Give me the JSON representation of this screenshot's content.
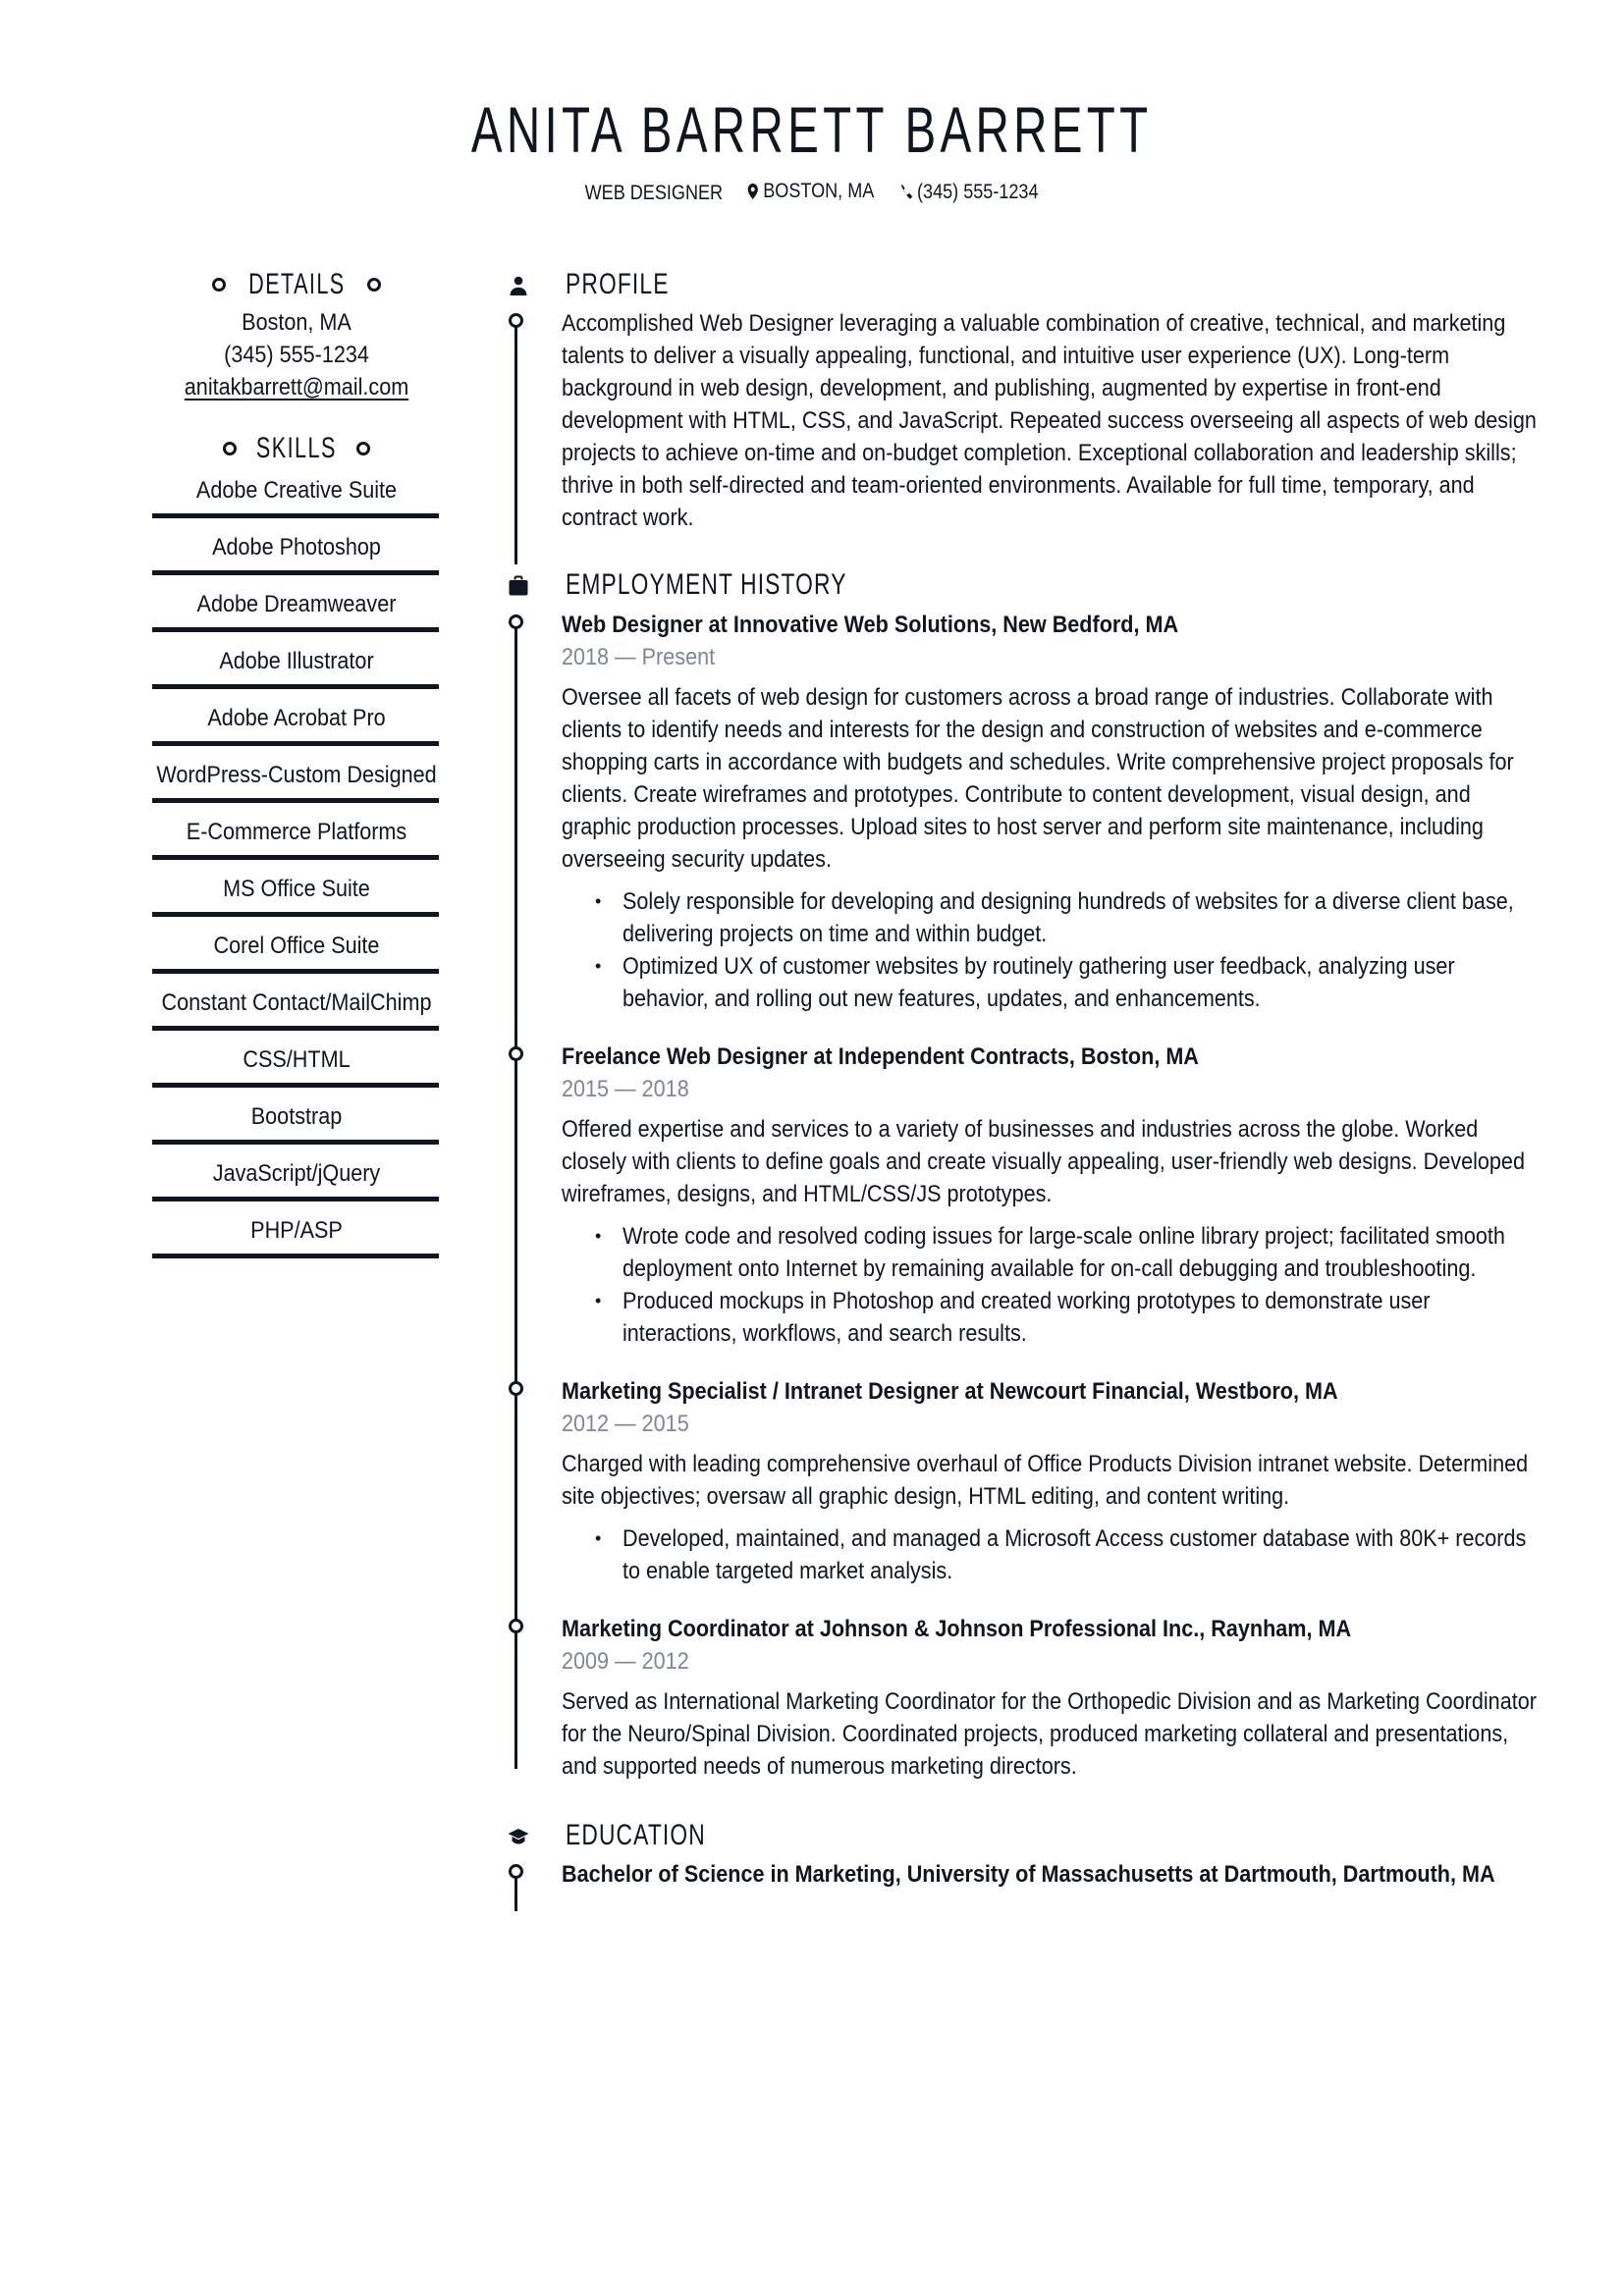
{
  "header": {
    "name": "ANITA BARRETT BARRETT",
    "job_title": "WEB DESIGNER",
    "location": "BOSTON, MA",
    "phone": "(345) 555-1234",
    "location_icon": "map-pin-icon",
    "phone_icon": "phone-icon"
  },
  "details": {
    "heading": "DETAILS",
    "city": "Boston, MA",
    "phone": "(345) 555-1234",
    "email": "anitakbarrett@mail.com"
  },
  "skills": {
    "heading": "SKILLS",
    "items": [
      {
        "name": "Adobe Creative Suite",
        "level": 1.0
      },
      {
        "name": "Adobe Photoshop",
        "level": 1.0
      },
      {
        "name": "Adobe Dreamweaver",
        "level": 1.0
      },
      {
        "name": "Adobe Illustrator",
        "level": 1.0
      },
      {
        "name": "Adobe Acrobat Pro",
        "level": 1.0
      },
      {
        "name": "WordPress-Custom Designed",
        "level": 1.0
      },
      {
        "name": "E-Commerce Platforms",
        "level": 1.0
      },
      {
        "name": "MS Office Suite",
        "level": 1.0
      },
      {
        "name": "Corel Office Suite",
        "level": 1.0
      },
      {
        "name": "Constant Contact/MailChimp",
        "level": 1.0
      },
      {
        "name": "CSS/HTML",
        "level": 1.0
      },
      {
        "name": "Bootstrap",
        "level": 1.0
      },
      {
        "name": "JavaScript/jQuery",
        "level": 1.0
      },
      {
        "name": "PHP/ASP",
        "level": 1.0
      }
    ]
  },
  "profile": {
    "heading": "PROFILE",
    "icon": "person-icon",
    "text": "Accomplished Web Designer leveraging a valuable combination of creative, technical, and marketing talents to deliver a visually appealing, functional, and intuitive user experience (UX). Long-term background in web design, development, and publishing, augmented by expertise in front-end development with HTML, CSS, and JavaScript. Repeated success overseeing all aspects of web design projects to achieve on-time and on-budget completion. Exceptional collaboration and leadership skills; thrive in both self-directed and team-oriented environments. Available for full time, temporary, and contract work."
  },
  "employment": {
    "heading": "EMPLOYMENT HISTORY",
    "icon": "briefcase-icon",
    "jobs": [
      {
        "title": "Web Designer at Innovative Web Solutions,  New Bedford, MA",
        "dates": "2018 — Present",
        "description": "Oversee all facets of web design for customers across a broad range of industries. Collaborate with clients to identify needs and interests for the design and construction of websites and e-commerce shopping carts in accordance with budgets and schedules. Write comprehensive project proposals for clients. Create wireframes and prototypes. Contribute to content development, visual design, and graphic production processes. Upload sites to host server and perform site maintenance, including overseeing security updates.",
        "bullets": [
          "Solely responsible for developing and designing hundreds of websites for a diverse client base, delivering projects on time and within budget.",
          "Optimized UX of customer websites by routinely gathering user feedback, analyzing user behavior, and rolling out new features, updates, and enhancements."
        ]
      },
      {
        "title": "Freelance Web Designer at Independent Contracts, Boston, MA",
        "dates": "2015 — 2018",
        "description": "Offered expertise and services to a variety of businesses and industries across the globe. Worked closely with clients to define goals and create visually appealing, user-friendly web designs. Developed wireframes, designs, and HTML/CSS/JS prototypes.",
        "bullets": [
          "Wrote code and resolved coding issues for large-scale online library project; facilitated smooth deployment onto Internet by remaining available for on-call debugging and troubleshooting.",
          "Produced mockups in Photoshop and created working prototypes to demonstrate user interactions, workflows, and search results."
        ]
      },
      {
        "title": "Marketing Specialist / Intranet Designer at Newcourt Financial, Westboro, MA",
        "dates": "2012 — 2015",
        "description": "Charged with leading comprehensive overhaul of Office Products Division intranet website. Determined site objectives; oversaw all graphic design, HTML editing, and content writing.",
        "bullets": [
          "Developed, maintained, and managed a Microsoft Access customer database with 80K+ records to enable targeted market analysis."
        ]
      },
      {
        "title": "Marketing Coordinator at Johnson & Johnson Professional Inc., Raynham, MA",
        "dates": "2009 — 2012",
        "description": "Served as International Marketing Coordinator for the Orthopedic Division and as Marketing Coordinator for the Neuro/Spinal Division. Coordinated projects, produced marketing collateral and presentations, and supported needs of numerous marketing directors.",
        "bullets": []
      }
    ]
  },
  "education": {
    "heading": "EDUCATION",
    "icon": "graduation-cap-icon",
    "entries": [
      {
        "degree": "Bachelor of Science in Marketing, University of Massachusetts at Dartmouth, Dartmouth, MA"
      }
    ]
  },
  "colors": {
    "text": "#0f1621",
    "date": "#7b8698",
    "skill_track": "#e6e8ec"
  }
}
